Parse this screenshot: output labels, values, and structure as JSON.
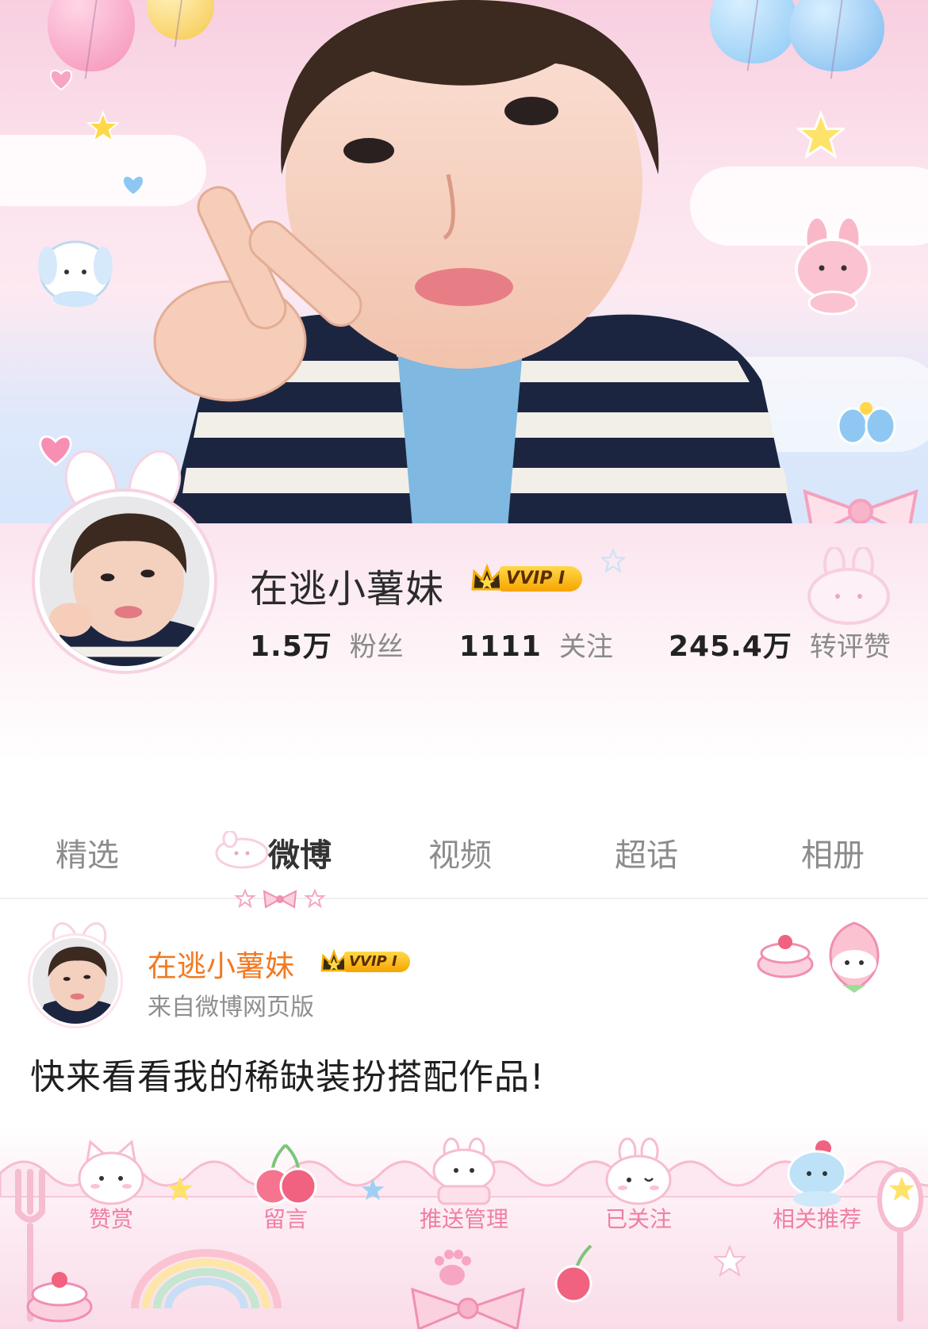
{
  "profile": {
    "name": "在逃小薯妹",
    "vip_label": "VVIP I",
    "stats": [
      {
        "value": "1.5万",
        "label": "粉丝"
      },
      {
        "value": "1111",
        "label": "关注"
      },
      {
        "value": "245.4万",
        "label": "转评赞"
      }
    ]
  },
  "tabs": [
    {
      "label": "精选"
    },
    {
      "label": "微博"
    },
    {
      "label": "视频"
    },
    {
      "label": "超话"
    },
    {
      "label": "相册"
    }
  ],
  "active_tab": "微博",
  "post": {
    "author": "在逃小薯妹",
    "vip_label": "VVIP I",
    "source": "来自微博网页版",
    "text": "快来看看我的稀缺装扮搭配作品!"
  },
  "actions": [
    {
      "label": "赞赏",
      "icon": "kitty-icon"
    },
    {
      "label": "留言",
      "icon": "cherry-icon"
    },
    {
      "label": "推送管理",
      "icon": "bunny-cake-icon"
    },
    {
      "label": "已关注",
      "icon": "bunny-icon"
    },
    {
      "label": "相关推荐",
      "icon": "icecream-icon"
    }
  ],
  "colors": {
    "accent_pink": "#ef7fa2",
    "author_orange": "#f07a24",
    "vip_gold": "#f6a400"
  }
}
